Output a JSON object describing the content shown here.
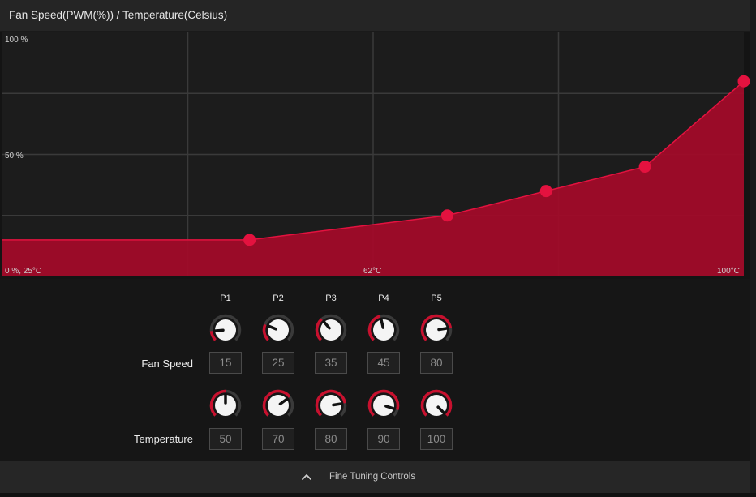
{
  "header": {
    "title": "Fan Speed(PWM(%)) / Temperature(Celsius)"
  },
  "colors": {
    "accent": "#c8102e",
    "fill": "#a50a29",
    "point": "#e3123f",
    "grid": "#3a3a3a"
  },
  "chart_data": {
    "type": "area",
    "x": [
      25,
      50,
      70,
      80,
      90,
      100
    ],
    "y": [
      15,
      15,
      25,
      35,
      45,
      80
    ],
    "points": [
      {
        "x": 50,
        "y": 15
      },
      {
        "x": 70,
        "y": 25
      },
      {
        "x": 80,
        "y": 35
      },
      {
        "x": 90,
        "y": 45
      },
      {
        "x": 100,
        "y": 80
      }
    ],
    "xlim": [
      25,
      100
    ],
    "ylim": [
      0,
      100
    ],
    "labels": {
      "y_top": "100 %",
      "y_mid": "50 %",
      "origin": "0 %, 25°C",
      "x_mid": "62°C",
      "x_max": "100°C"
    },
    "grid": true
  },
  "controls": {
    "columns": [
      "P1",
      "P2",
      "P3",
      "P4",
      "P5"
    ],
    "fan_speed_label": "Fan Speed",
    "temperature_label": "Temperature",
    "fan_speed": [
      "15",
      "25",
      "35",
      "45",
      "80"
    ],
    "temperature": [
      "50",
      "70",
      "80",
      "90",
      "100"
    ]
  },
  "footer": {
    "label": "Fine Tuning Controls",
    "icon": "chevron-up-icon"
  }
}
